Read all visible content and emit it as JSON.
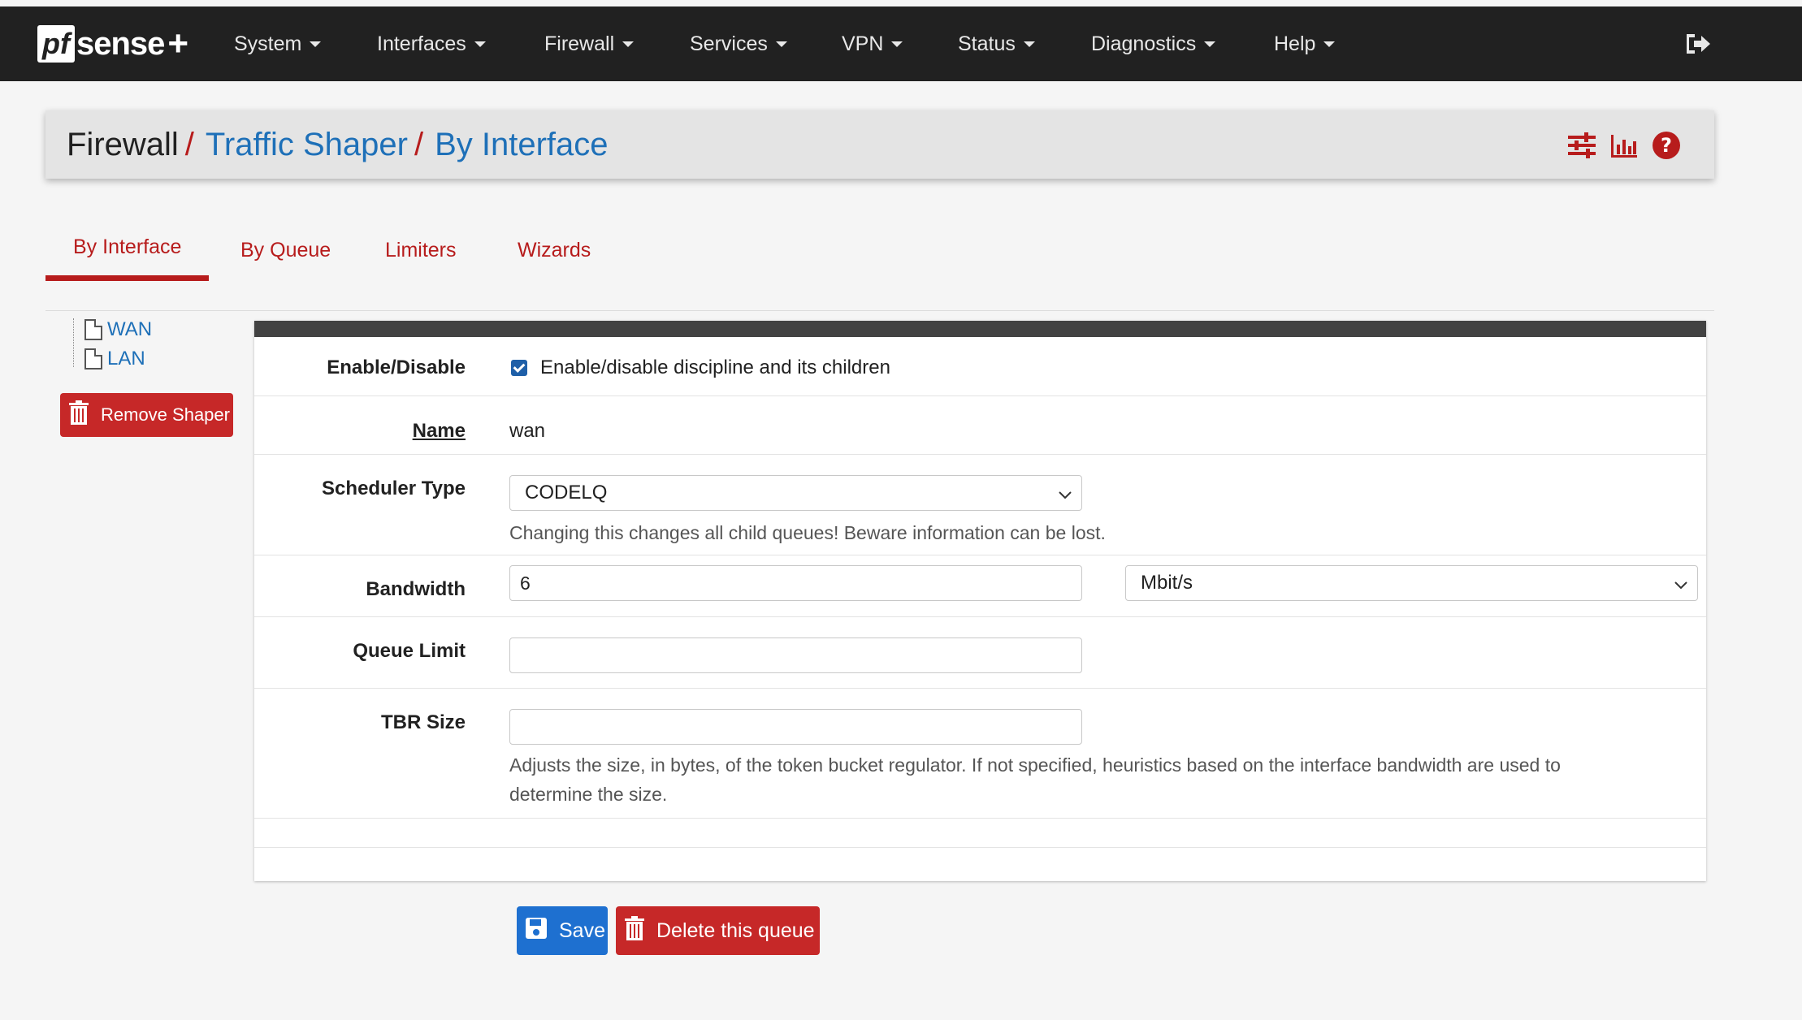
{
  "brand": {
    "pf": "pf",
    "sense": "sense",
    "plus": "+"
  },
  "nav": {
    "items": [
      "System",
      "Interfaces",
      "Firewall",
      "Services",
      "VPN",
      "Status",
      "Diagnostics",
      "Help"
    ]
  },
  "breadcrumb": {
    "root": "Firewall",
    "sep1": "/",
    "level2": "Traffic Shaper",
    "sep2": "/",
    "level3": "By Interface"
  },
  "tabs": [
    "By Interface",
    "By Queue",
    "Limiters",
    "Wizards"
  ],
  "tree": {
    "items": [
      "WAN",
      "LAN"
    ]
  },
  "remove_shaper_label": "Remove Shaper",
  "form": {
    "enable": {
      "label": "Enable/Disable",
      "checked": true,
      "text": "Enable/disable discipline and its children"
    },
    "name": {
      "label": "Name",
      "value": "wan"
    },
    "scheduler": {
      "label": "Scheduler Type",
      "value": "CODELQ",
      "help": "Changing this changes all child queues! Beware information can be lost."
    },
    "bandwidth": {
      "label": "Bandwidth",
      "value": "6",
      "unit": "Mbit/s"
    },
    "queue_limit": {
      "label": "Queue Limit",
      "value": ""
    },
    "tbr": {
      "label": "TBR Size",
      "value": "",
      "help_line1": "Adjusts the size, in bytes, of the token bucket regulator. If not specified, heuristics based on the interface bandwidth are used to",
      "help_line2": "determine the size."
    }
  },
  "buttons": {
    "save": "Save",
    "delete": "Delete this queue"
  },
  "colors": {
    "accent_red": "#b71c1c",
    "link_blue": "#1e70b8",
    "save_blue": "#1e70d0",
    "navbar": "#212121"
  }
}
